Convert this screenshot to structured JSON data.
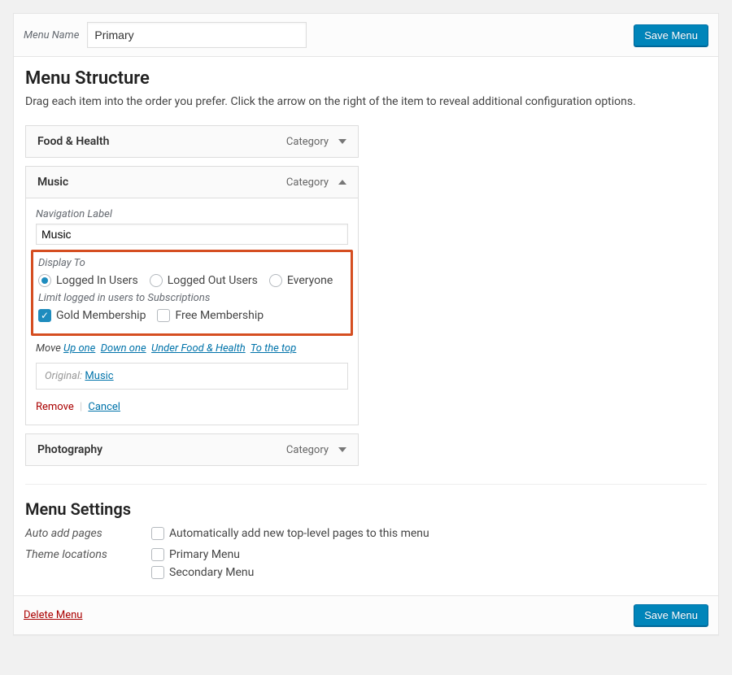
{
  "header": {
    "menu_name_label": "Menu Name",
    "menu_name_value": "Primary",
    "save_button": "Save Menu"
  },
  "structure": {
    "heading": "Menu Structure",
    "description": "Drag each item into the order you prefer. Click the arrow on the right of the item to reveal additional configuration options.",
    "items": [
      {
        "title": "Food & Health",
        "type": "Category",
        "expanded": false
      },
      {
        "title": "Music",
        "type": "Category",
        "expanded": true
      },
      {
        "title": "Photography",
        "type": "Category",
        "expanded": false
      }
    ]
  },
  "music_settings": {
    "nav_label_label": "Navigation Label",
    "nav_label_value": "Music",
    "display_to_label": "Display To",
    "display_options": [
      {
        "label": "Logged In Users",
        "checked": true
      },
      {
        "label": "Logged Out Users",
        "checked": false
      },
      {
        "label": "Everyone",
        "checked": false
      }
    ],
    "limit_label": "Limit logged in users to Subscriptions",
    "subscriptions": [
      {
        "label": "Gold Membership",
        "checked": true
      },
      {
        "label": "Free Membership",
        "checked": false
      }
    ],
    "move_label": "Move",
    "move_links": [
      "Up one",
      "Down one",
      "Under Food & Health",
      "To the top"
    ],
    "original_label": "Original:",
    "original_value": "Music",
    "remove_label": "Remove",
    "cancel_label": "Cancel"
  },
  "settings": {
    "heading": "Menu Settings",
    "auto_add_label": "Auto add pages",
    "auto_add_option": "Automatically add new top-level pages to this menu",
    "theme_loc_label": "Theme locations",
    "theme_locations": [
      "Primary Menu",
      "Secondary Menu"
    ]
  },
  "footer": {
    "delete_label": "Delete Menu",
    "save_button": "Save Menu"
  }
}
